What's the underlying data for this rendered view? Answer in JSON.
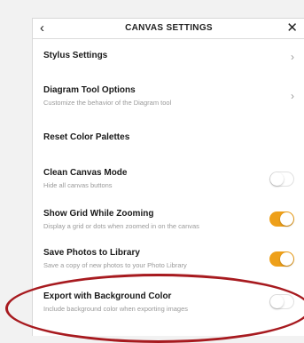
{
  "header": {
    "back_icon": "‹",
    "title": "CANVAS SETTINGS",
    "close_icon": "✕"
  },
  "rows": [
    {
      "title": "Stylus Settings",
      "subtitle": "",
      "control": "chevron",
      "chevron": "›"
    },
    {
      "title": "Diagram Tool Options",
      "subtitle": "Customize the behavior of the Diagram tool",
      "control": "chevron",
      "chevron": "›"
    },
    {
      "title": "Reset Color Palettes",
      "subtitle": "",
      "control": "none"
    },
    {
      "title": "Clean Canvas Mode",
      "subtitle": "Hide all canvas buttons",
      "control": "toggle",
      "on": false
    },
    {
      "title": "Show Grid While Zooming",
      "subtitle": "Display a grid or dots when zoomed in on the canvas",
      "control": "toggle",
      "on": true
    },
    {
      "title": "Save Photos to Library",
      "subtitle": "Save a copy of new photos to your Photo Library",
      "control": "toggle",
      "on": true
    },
    {
      "title": "Export with Background Color",
      "subtitle": "Include background color when exporting images",
      "control": "toggle",
      "on": false
    }
  ],
  "colors": {
    "toggle_on": "#eea01a",
    "annotation": "#a71a1f"
  }
}
